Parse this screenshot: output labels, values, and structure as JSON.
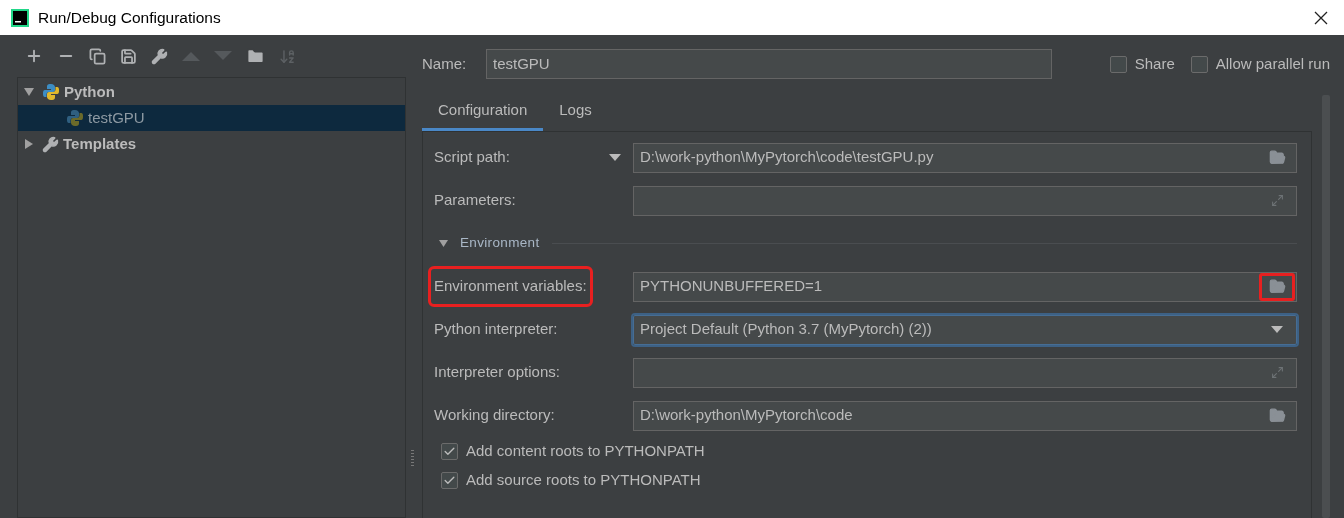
{
  "window": {
    "title": "Run/Debug Configurations"
  },
  "tree": [
    {
      "label": "Python",
      "expanded": true,
      "selected": false,
      "children": [
        {
          "label": "testGPU",
          "selected": true
        }
      ]
    },
    {
      "label": "Templates",
      "expanded": false,
      "selected": false
    }
  ],
  "name_field": {
    "label": "Name:",
    "value": "testGPU"
  },
  "options": [
    {
      "label": "Share",
      "checked": false
    },
    {
      "label": "Allow parallel run",
      "checked": false
    }
  ],
  "tabs": [
    {
      "label": "Configuration",
      "selected": true
    },
    {
      "label": "Logs",
      "selected": false
    }
  ],
  "rows": [
    {
      "kind": "browse",
      "label": "Script path:",
      "label_dropdown": true,
      "value": "D:\\work-python\\MyPytorch\\code\\testGPU.py",
      "focused": false,
      "label_highlighted": false,
      "button_highlighted": false
    },
    {
      "kind": "expand",
      "label": "Parameters:",
      "label_dropdown": false,
      "focused": false,
      "label_highlighted": false,
      "button_highlighted": false
    },
    {
      "kind": "section",
      "label": "Environment",
      "expanded": true
    },
    {
      "kind": "browse",
      "label": "Environment variables:",
      "label_dropdown": false,
      "value": "PYTHONUNBUFFERED=1",
      "focused": false,
      "label_highlighted": true,
      "button_highlighted": true
    },
    {
      "kind": "select",
      "label": "Python interpreter:",
      "label_dropdown": false,
      "value": "Project Default (Python 3.7 (MyPytorch) (2))",
      "focused": true,
      "label_highlighted": false,
      "button_highlighted": false
    },
    {
      "kind": "expand",
      "label": "Interpreter options:",
      "label_dropdown": false,
      "focused": false,
      "label_highlighted": false,
      "button_highlighted": false
    },
    {
      "kind": "browse",
      "label": "Working directory:",
      "label_dropdown": false,
      "value": "D:\\work-python\\MyPytorch\\code",
      "focused": false,
      "label_highlighted": false,
      "button_highlighted": false
    },
    {
      "kind": "checkbox",
      "label": "Add content roots to PYTHONPATH",
      "checked": true
    },
    {
      "kind": "checkbox",
      "label": "Add source roots to PYTHONPATH",
      "checked": true
    }
  ]
}
